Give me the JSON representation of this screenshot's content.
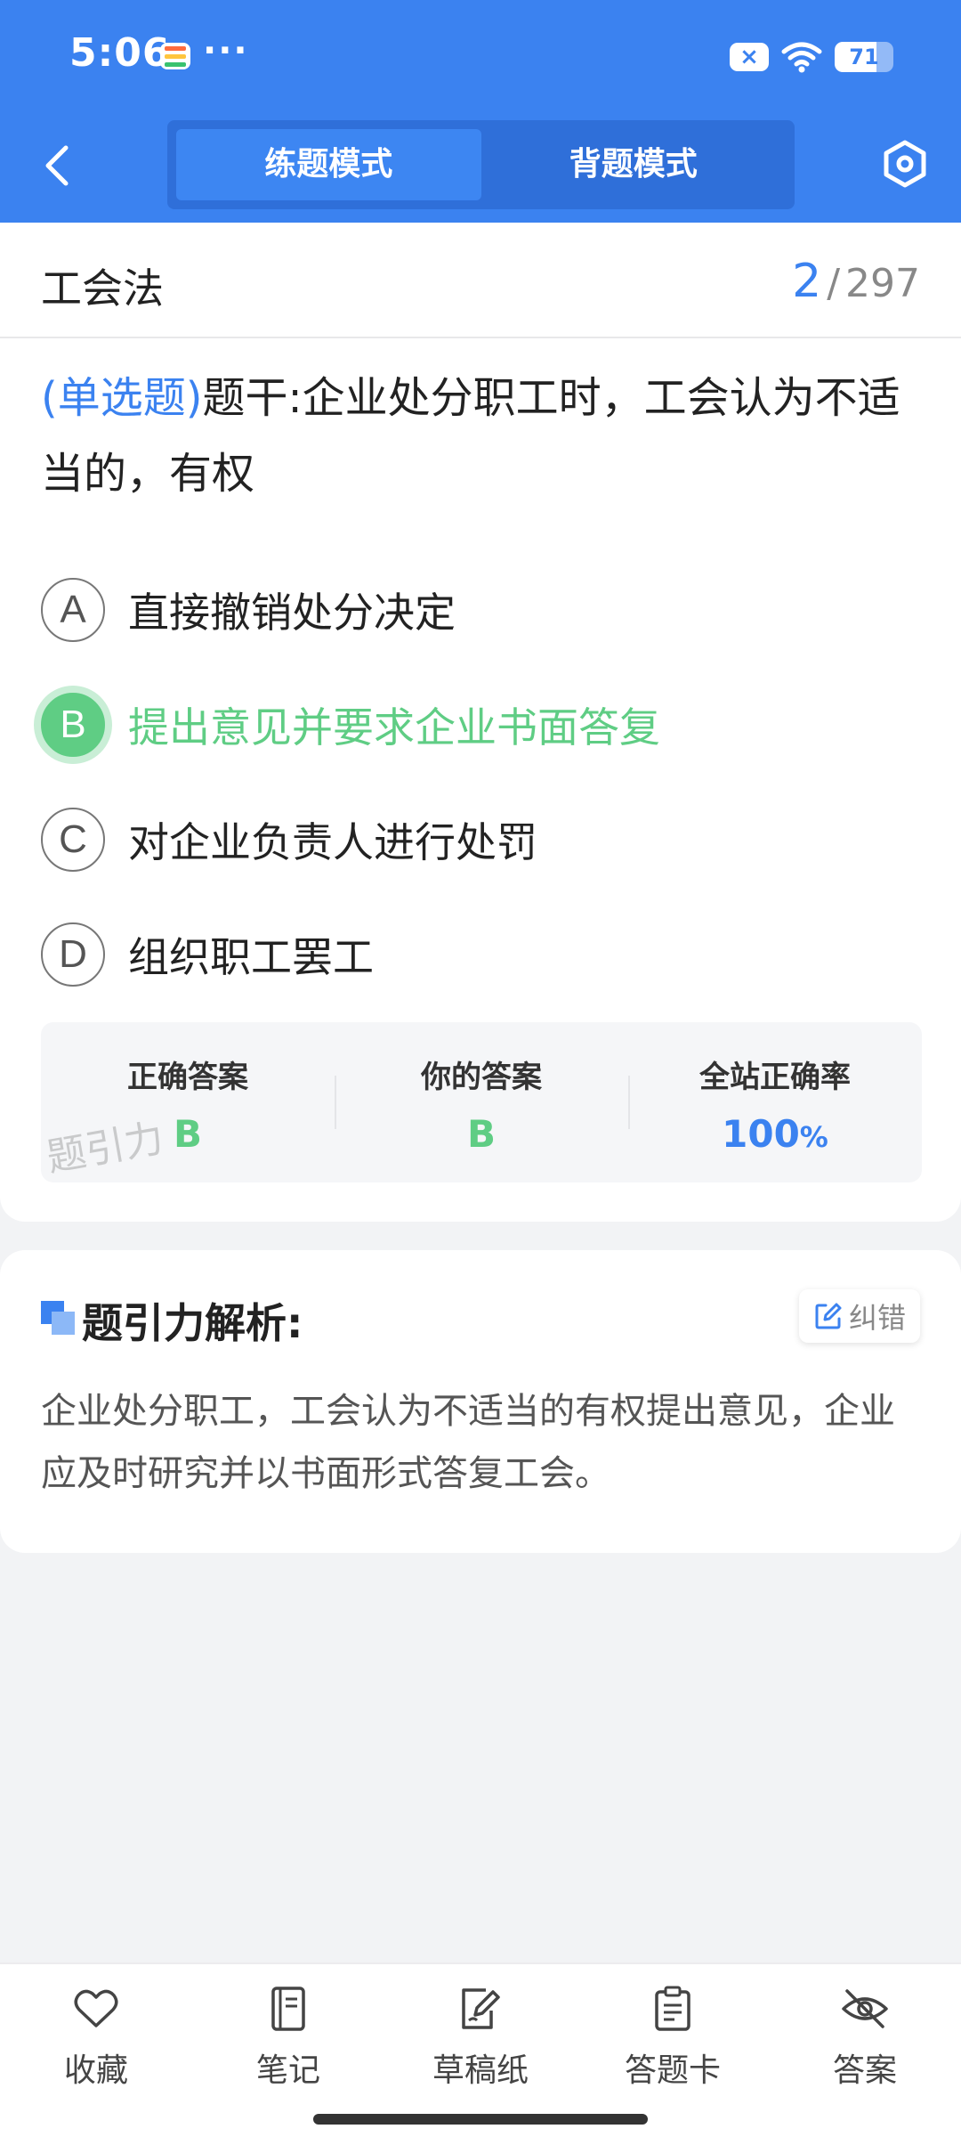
{
  "status_bar": {
    "time": "5:06",
    "more_dots": "···",
    "notification_badge": "×",
    "battery_level": 71,
    "battery_label": "71"
  },
  "header": {
    "back_icon": "chevron-left-icon",
    "modes": [
      {
        "label": "练题模式",
        "active": true
      },
      {
        "label": "背题模式",
        "active": false
      }
    ],
    "settings_icon": "hexagon-settings-icon"
  },
  "question_card": {
    "subject": "工会法",
    "progress_current": "2",
    "progress_separator": "/",
    "progress_total": "297",
    "question_type": "(单选题)",
    "question_text": "题干:企业处分职工时，工会认为不适当的，有权",
    "options": [
      {
        "letter": "A",
        "text": "直接撤销处分决定",
        "state": "normal"
      },
      {
        "letter": "B",
        "text": "提出意见并要求企业书面答复",
        "state": "correct"
      },
      {
        "letter": "C",
        "text": "对企业负责人进行处罚",
        "state": "normal"
      },
      {
        "letter": "D",
        "text": "组织职工罢工",
        "state": "normal"
      }
    ],
    "stats": {
      "correct_answer_label": "正确答案",
      "correct_answer": "B",
      "your_answer_label": "你的答案",
      "your_answer": "B",
      "accuracy_label": "全站正确率",
      "accuracy_value": "100",
      "accuracy_unit": "%"
    },
    "watermark": "题引力"
  },
  "analysis": {
    "title": "题引力解析:",
    "report_label": "纠错",
    "body": "企业处分职工，工会认为不适当的有权提出意见，企业应及时研究并以书面形式答复工会。"
  },
  "bottom_bar": {
    "tabs": [
      {
        "label": "收藏",
        "icon": "heart-icon"
      },
      {
        "label": "笔记",
        "icon": "notebook-icon"
      },
      {
        "label": "草稿纸",
        "icon": "draft-paper-icon"
      },
      {
        "label": "答题卡",
        "icon": "answer-sheet-icon"
      },
      {
        "label": "答案",
        "icon": "eye-off-icon"
      }
    ]
  },
  "colors": {
    "primary": "#3b82f0",
    "correct": "#5fcd84",
    "background": "#f2f3f5"
  }
}
